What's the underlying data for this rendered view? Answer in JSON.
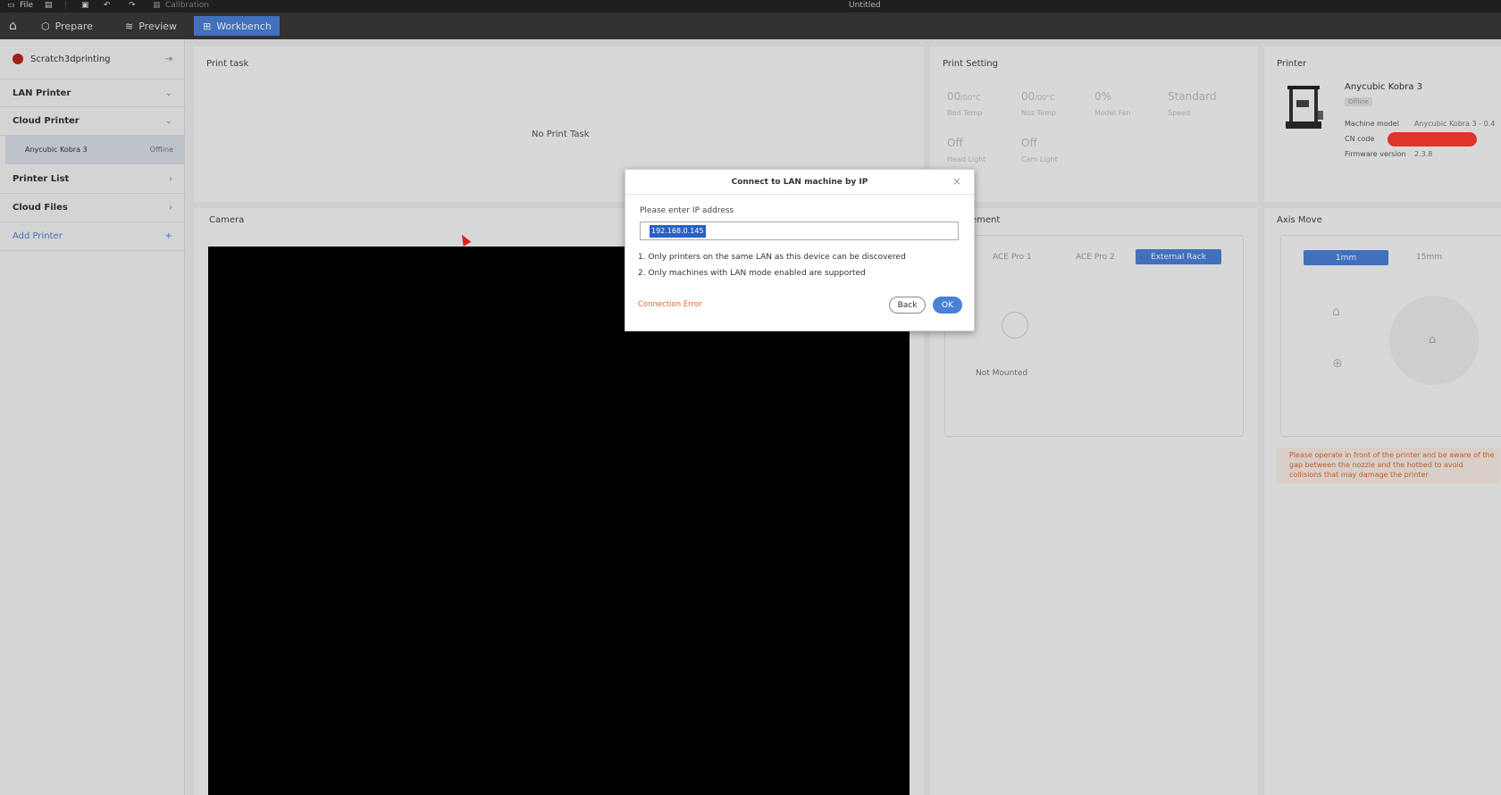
{
  "menubar": {
    "file": "File",
    "calibration": "Calibration",
    "window_title": "Untitled"
  },
  "tabs": [
    {
      "label": "Prepare"
    },
    {
      "label": "Preview"
    },
    {
      "label": "Workbench"
    }
  ],
  "sidebar": {
    "account": "Scratch3dprinting",
    "lan_printer": "LAN Printer",
    "cloud_printer": "Cloud Printer",
    "printer_item": {
      "name": "Anycubic Kobra 3",
      "status": "Offline"
    },
    "printer_list": "Printer List",
    "cloud_files": "Cloud Files",
    "add_printer": "Add Printer"
  },
  "print_task": {
    "title": "Print task",
    "empty": "No Print Task"
  },
  "print_setting": {
    "title": "Print Setting",
    "bed_temp": {
      "value": "00",
      "unit": "/00°C",
      "label": "Bed Temp"
    },
    "noz_temp": {
      "value": "00",
      "unit": "/00°C",
      "label": "Noz Temp"
    },
    "model_fan": {
      "value": "0%",
      "label": "Model Fan"
    },
    "speed": {
      "value": "Standard",
      "label": "Speed"
    },
    "head_light": {
      "value": "Off",
      "label": "Head Light"
    },
    "cam_light": {
      "value": "Off",
      "label": "Cam Light"
    }
  },
  "printer": {
    "title": "Printer",
    "name": "Anycubic Kobra 3",
    "status": "Offline",
    "model_label": "Machine model",
    "model_value": "Anycubic Kobra 3 - 0.4",
    "cn_label": "CN code",
    "fw_label": "Firmware version",
    "fw_value": "2.3.8",
    "redact_color": "#ff3b30"
  },
  "camera": {
    "title": "Camera"
  },
  "filament": {
    "title": "ement",
    "tabs": [
      "ACE Pro 1",
      "ACE Pro 2",
      "External Rack"
    ],
    "status": "Not Mounted"
  },
  "axis_move": {
    "title": "Axis Move",
    "steps": [
      "1mm",
      "15mm"
    ],
    "warning": "Please operate in front of the printer and be aware of the gap between the nozzle and the hotbed to avoid collisions that may damage the printer"
  },
  "dialog": {
    "title": "Connect to LAN machine by IP",
    "prompt": "Please enter IP address",
    "ip_value": "192.168.0.145",
    "note1": "1. Only printers on the same LAN as this device can be discovered",
    "note2": "2. Only machines with LAN mode enabled are supported",
    "error": "Connection Error",
    "back": "Back",
    "ok": "OK"
  },
  "colors": {
    "accent": "#4a80d8",
    "error": "#e0672a",
    "dark": "#242424"
  }
}
